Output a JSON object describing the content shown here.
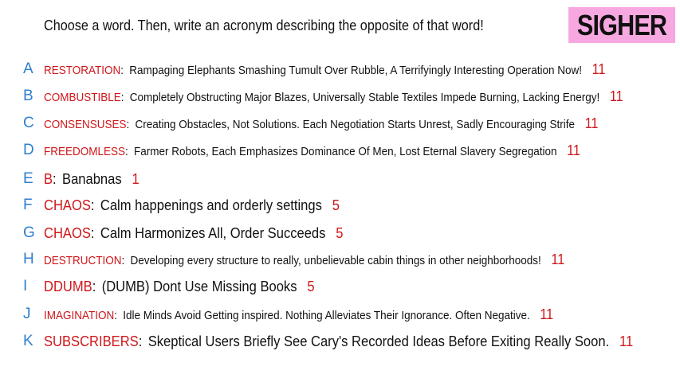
{
  "prompt": "Choose a word. Then, write an acronym describing the opposite of that word!",
  "game_name": "SIGHER",
  "colors": {
    "letter": "#2f7fcf",
    "word": "#d0161a",
    "score": "#d0161a",
    "tag_background": "#f7a8e0"
  },
  "entries": [
    {
      "letter": "A",
      "word": "RESTORATION",
      "acronym": "Rampaging Elephants Smashing Tumult Over Rubble, A Terrifyingly Interesting Operation Now!",
      "score": "11"
    },
    {
      "letter": "B",
      "word": "COMBUSTIBLE",
      "acronym": "Completely Obstructing Major Blazes, Universally Stable Textiles Impede Burning, Lacking Energy!",
      "score": "11"
    },
    {
      "letter": "C",
      "word": "CONSENSUSES",
      "acronym": "Creating Obstacles, Not Solutions. Each Negotiation Starts Unrest, Sadly Encouraging Strife",
      "score": "11"
    },
    {
      "letter": "D",
      "word": "FREEDOMLESS",
      "acronym": "Farmer Robots, Each Emphasizes Dominance Of Men, Lost Eternal Slavery Segregation",
      "score": "11"
    },
    {
      "letter": "E",
      "word": "B",
      "acronym": "Banabnas",
      "score": "1"
    },
    {
      "letter": "F",
      "word": "CHAOS",
      "acronym": "Calm happenings and orderly settings",
      "score": "5"
    },
    {
      "letter": "G",
      "word": "CHAOS",
      "acronym": "Calm Harmonizes All, Order Succeeds",
      "score": "5"
    },
    {
      "letter": "H",
      "word": "DESTRUCTION",
      "acronym": "Developing every structure to really, unbelievable cabin things in other neighborhoods!",
      "score": "11"
    },
    {
      "letter": "I",
      "word": "DDUMB",
      "acronym": "(DUMB) Dont Use Missing Books",
      "score": "5"
    },
    {
      "letter": "J",
      "word": "IMAGINATION",
      "acronym": "Idle Minds Avoid Getting inspired. Nothing Alleviates Their Ignorance. Often Negative.",
      "score": "11"
    },
    {
      "letter": "K",
      "word": "SUBSCRIBERS",
      "acronym": "Skeptical Users Briefly See Cary's Recorded Ideas Before Exiting Really Soon.",
      "score": "11"
    }
  ]
}
